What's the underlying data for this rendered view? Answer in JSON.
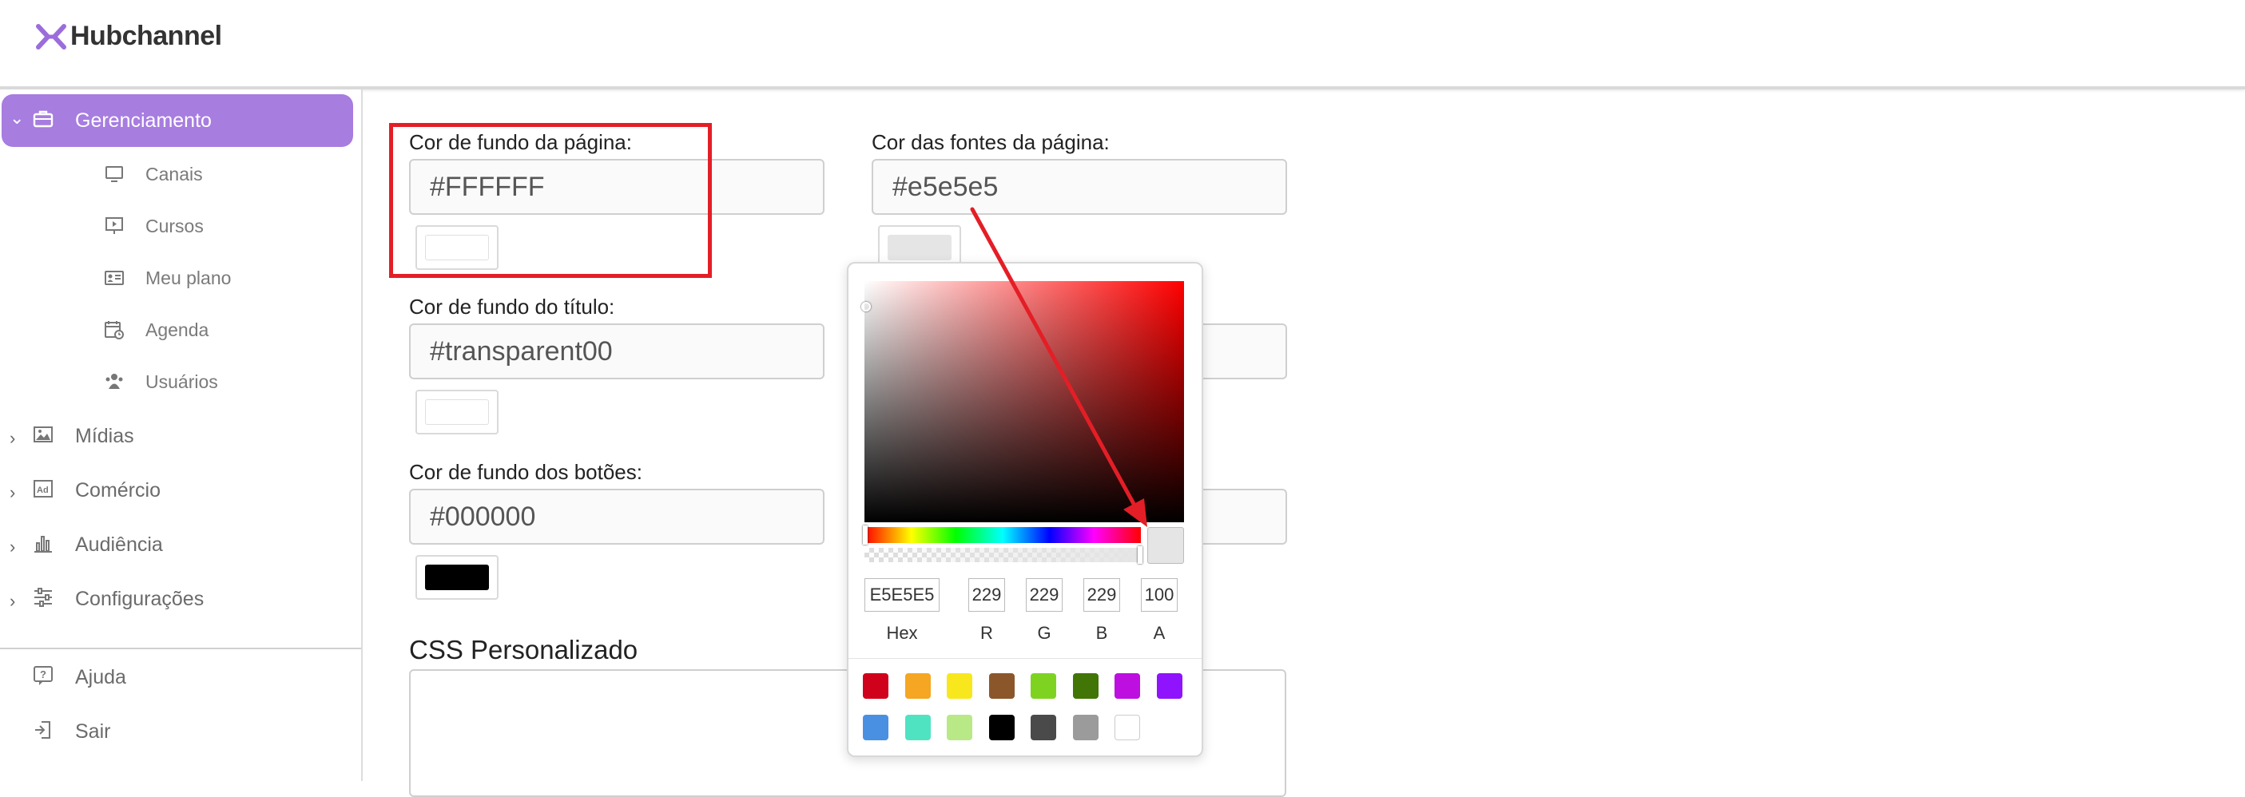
{
  "app": {
    "name": "Hubchannel",
    "brand_color": "#a77de0"
  },
  "sidebar": {
    "active": "Gerenciamento",
    "items": [
      {
        "label": "Gerenciamento",
        "icon": "briefcase-icon"
      },
      {
        "label": "Canais",
        "icon": "monitor-icon"
      },
      {
        "label": "Cursos",
        "icon": "presentation-icon"
      },
      {
        "label": "Meu plano",
        "icon": "id-card-icon"
      },
      {
        "label": "Agenda",
        "icon": "calendar-clock-icon"
      },
      {
        "label": "Usuários",
        "icon": "users-icon"
      },
      {
        "label": "Mídias",
        "icon": "image-icon"
      },
      {
        "label": "Comércio",
        "icon": "ad-icon"
      },
      {
        "label": "Audiência",
        "icon": "bar-chart-icon"
      },
      {
        "label": "Configurações",
        "icon": "sliders-icon"
      },
      {
        "label": "Ajuda",
        "icon": "help-icon"
      },
      {
        "label": "Sair",
        "icon": "logout-icon"
      }
    ]
  },
  "form": {
    "page_bg": {
      "label": "Cor de fundo da página:",
      "value": "#FFFFFF",
      "swatch": "#ffffff"
    },
    "page_font": {
      "label": "Cor das fontes da página:",
      "value": "#e5e5e5",
      "swatch": "#e5e5e5"
    },
    "title_bg": {
      "label": "Cor de fundo do título:",
      "value": "#transparent00",
      "swatch": "#ffffff"
    },
    "buttons_bg": {
      "label": "Cor de fundo dos botões:",
      "value": "#000000",
      "swatch": "#000000"
    },
    "css_title": "CSS Personalizado"
  },
  "picker": {
    "hex": "E5E5E5",
    "r": "229",
    "g": "229",
    "b": "229",
    "a": "100",
    "labels": {
      "hex": "Hex",
      "r": "R",
      "g": "G",
      "b": "B",
      "a": "A"
    },
    "presets": [
      "#d0021b",
      "#f5a623",
      "#f8e71c",
      "#8b572a",
      "#7ed321",
      "#417505",
      "#bd10e0",
      "#9013fe",
      "#4a90e2",
      "#50e3c2",
      "#b8e986",
      "#000000",
      "#4a4a4a",
      "#9b9b9b",
      "#ffffff"
    ]
  },
  "annotation_color": "#e41e26"
}
